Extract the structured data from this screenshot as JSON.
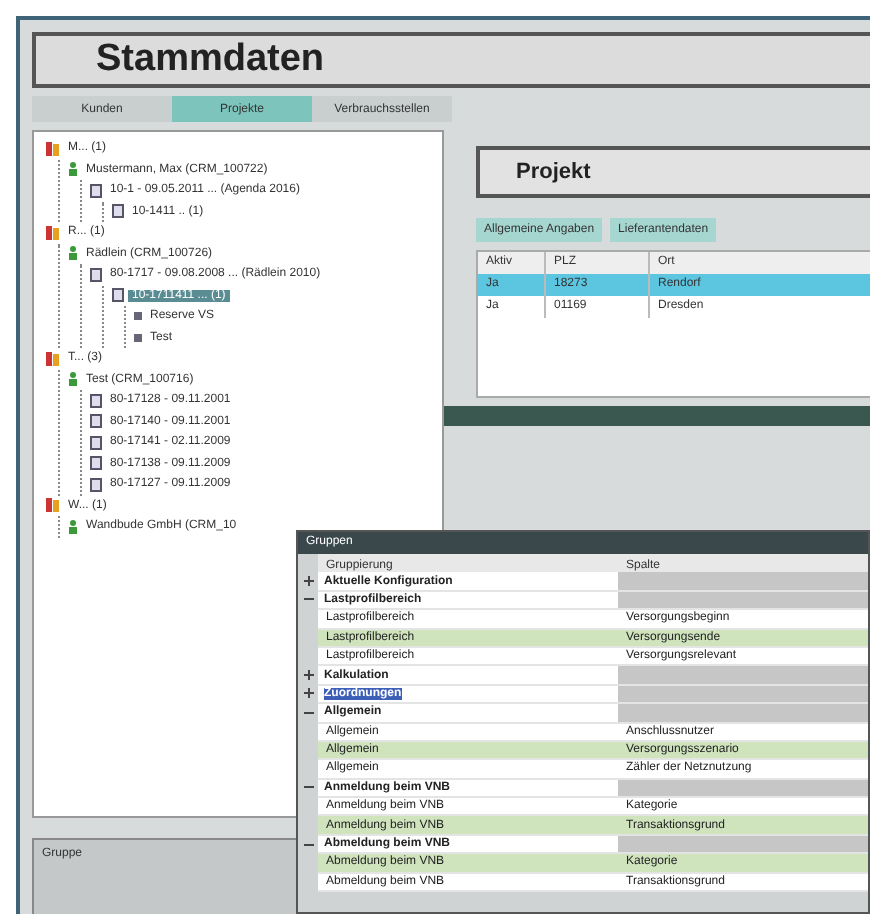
{
  "window": {
    "title": "Stammdaten"
  },
  "tabs": [
    {
      "label": "Kunden",
      "selected": false
    },
    {
      "label": "Projekte",
      "selected": true
    },
    {
      "label": "Verbrauchsstellen",
      "selected": false
    }
  ],
  "tree": [
    {
      "label": "M... (1)",
      "kind": "group",
      "selected": false,
      "children": [
        {
          "label": "Mustermann, Max (CRM_100722)",
          "kind": "customer",
          "selected": false,
          "children": [
            {
              "label": "10-1 - 09.05.2011 ... (Agenda 2016)",
              "kind": "contract",
              "selected": false,
              "children": [
                {
                  "label": "10-1411 .. (1)",
                  "kind": "contract",
                  "selected": false
                }
              ]
            }
          ]
        }
      ]
    },
    {
      "label": "R... (1)",
      "kind": "group",
      "selected": false,
      "children": [
        {
          "label": "Rädlein (CRM_100726)",
          "kind": "customer",
          "selected": false,
          "children": [
            {
              "label": "80-1717 - 09.08.2008 ... (Rädlein 2010)",
              "kind": "contract",
              "selected": false,
              "children": [
                {
                  "label": "10-1711411 ... (1)",
                  "kind": "contract",
                  "selected": true,
                  "children": [
                    {
                      "label": "Reserve VS",
                      "kind": "leaf",
                      "selected": false
                    },
                    {
                      "label": "Test",
                      "kind": "leaf",
                      "selected": false
                    }
                  ]
                }
              ]
            }
          ]
        }
      ]
    },
    {
      "label": "T... (3)",
      "kind": "group",
      "selected": false,
      "children": [
        {
          "label": "Test (CRM_100716)",
          "kind": "customer",
          "selected": false,
          "children": [
            {
              "label": "80-17128 - 09.11.2001",
              "kind": "contract",
              "selected": false
            },
            {
              "label": "80-17140 - 09.11.2001",
              "kind": "contract",
              "selected": false
            },
            {
              "label": "80-17141 - 02.11.2009",
              "kind": "contract",
              "selected": false
            },
            {
              "label": "80-17138 - 09.11.2009",
              "kind": "contract",
              "selected": false
            },
            {
              "label": "80-17127 - 09.11.2009",
              "kind": "contract",
              "selected": false
            }
          ]
        }
      ]
    },
    {
      "label": "W... (1)",
      "kind": "group",
      "selected": false,
      "children": [
        {
          "label": "Wandbude GmbH (CRM_10",
          "kind": "customer",
          "selected": false
        }
      ]
    }
  ],
  "group_panel": {
    "label": "Gruppe"
  },
  "project": {
    "title": "Projekt",
    "tabs": [
      {
        "label": "Allgemeine Angaben",
        "selected": false
      },
      {
        "label": "Lieferantendaten",
        "selected": false
      }
    ],
    "columns": [
      "Aktiv",
      "PLZ",
      "Ort"
    ],
    "rows": [
      {
        "cells": [
          "Ja",
          "18273",
          "Rendorf"
        ],
        "selected": true
      },
      {
        "cells": [
          "Ja",
          "01169",
          "Dresden"
        ],
        "selected": false
      }
    ]
  },
  "dialog": {
    "title": "Gruppen",
    "columns": [
      "Gruppierung",
      "Spalte"
    ],
    "rows": [
      {
        "kind": "group",
        "label": "Aktuelle Konfiguration",
        "expanded": false,
        "selected": false
      },
      {
        "kind": "group",
        "label": "Lastprofilbereich",
        "expanded": true,
        "selected": false
      },
      {
        "kind": "item",
        "cells": [
          "Lastprofilbereich",
          "Versorgungsbeginn"
        ],
        "highlighted": false
      },
      {
        "kind": "item",
        "cells": [
          "Lastprofilbereich",
          "Versorgungsende"
        ],
        "highlighted": true
      },
      {
        "kind": "item",
        "cells": [
          "Lastprofilbereich",
          "Versorgungsrelevant"
        ],
        "highlighted": false
      },
      {
        "kind": "group",
        "label": "Kalkulation",
        "expanded": false,
        "selected": false
      },
      {
        "kind": "group",
        "label": "Zuordnungen",
        "expanded": false,
        "selected": true
      },
      {
        "kind": "group",
        "label": "Allgemein",
        "expanded": true,
        "selected": false
      },
      {
        "kind": "item",
        "cells": [
          "Allgemein",
          "Anschlussnutzer"
        ],
        "highlighted": false
      },
      {
        "kind": "item",
        "cells": [
          "Allgemein",
          "Versorgungsszenario"
        ],
        "highlighted": true
      },
      {
        "kind": "item",
        "cells": [
          "Allgemein",
          "Zähler der Netznutzung"
        ],
        "highlighted": false
      },
      {
        "kind": "group",
        "label": "Anmeldung beim VNB",
        "expanded": true,
        "selected": false
      },
      {
        "kind": "item",
        "cells": [
          "Anmeldung beim VNB",
          "Kategorie"
        ],
        "highlighted": false
      },
      {
        "kind": "item",
        "cells": [
          "Anmeldung beim VNB",
          "Transaktionsgrund"
        ],
        "highlighted": true
      },
      {
        "kind": "group",
        "label": "Abmeldung beim VNB",
        "expanded": true,
        "selected": false
      },
      {
        "kind": "item",
        "cells": [
          "Abmeldung beim VNB",
          "Kategorie"
        ],
        "highlighted": true
      },
      {
        "kind": "item",
        "cells": [
          "Abmeldung beim VNB",
          "Transaktionsgrund"
        ],
        "highlighted": false
      }
    ]
  }
}
